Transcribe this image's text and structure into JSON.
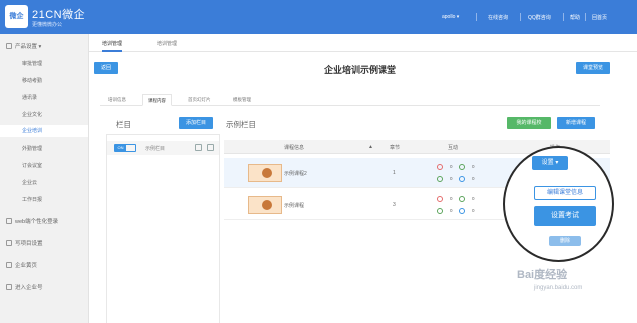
{
  "header": {
    "logo_text": "微企",
    "brand": "21CN微企",
    "brand_sub": "更懂微微办公",
    "user": "apollo",
    "nav": [
      "在线咨询",
      "QQ群咨询",
      "帮助",
      "回首页"
    ]
  },
  "sidebar": {
    "group_product": "产品设置",
    "items": [
      "审批管理",
      "移动考勤",
      "通讯录",
      "企业文化",
      "企业培训",
      "外勤管理",
      "订会议室",
      "企业云",
      "工作日报"
    ],
    "active_index": 4,
    "groups_bottom": [
      "web端个性化登录",
      "写项目设置",
      "企业黄页",
      "进入企业号"
    ]
  },
  "top_tabs": [
    "培训管理",
    "培训管理"
  ],
  "back_button": "返回",
  "page_title": "企业培训示例课堂",
  "save_button": "课堂预览",
  "mid_tabs": [
    "培训信息",
    "课程内容",
    "首页幻灯片",
    "模板管理"
  ],
  "left_section_title": "栏目",
  "add_column_button": "添加栏目",
  "toggle_label": "ON",
  "category_name": "示例栏目",
  "right_section_title": "示例栏目",
  "my_courses_button": "我的课程校",
  "new_course_button": "新增课程",
  "table": {
    "headers": [
      "课程信息",
      "章节",
      "互动",
      "操作"
    ],
    "rows": [
      {
        "name": "示例课程2",
        "chapters": "1",
        "likes": "0",
        "comments": "0",
        "shares": "0",
        "views": "0"
      },
      {
        "name": "示例课程",
        "chapters": "3",
        "likes": "0",
        "comments": "0",
        "shares": "0",
        "views": "0"
      }
    ]
  },
  "zoom": {
    "dropdown": "设置",
    "edit_info": "编辑课堂信息",
    "set_exam": "设置考试",
    "delete": "删除"
  },
  "watermark": {
    "text": "Bai度经验",
    "sub": "jingyan.baidu.com"
  },
  "colors": {
    "primary": "#3b7dd8",
    "button_blue": "#3b94e3",
    "button_green": "#56b868"
  }
}
